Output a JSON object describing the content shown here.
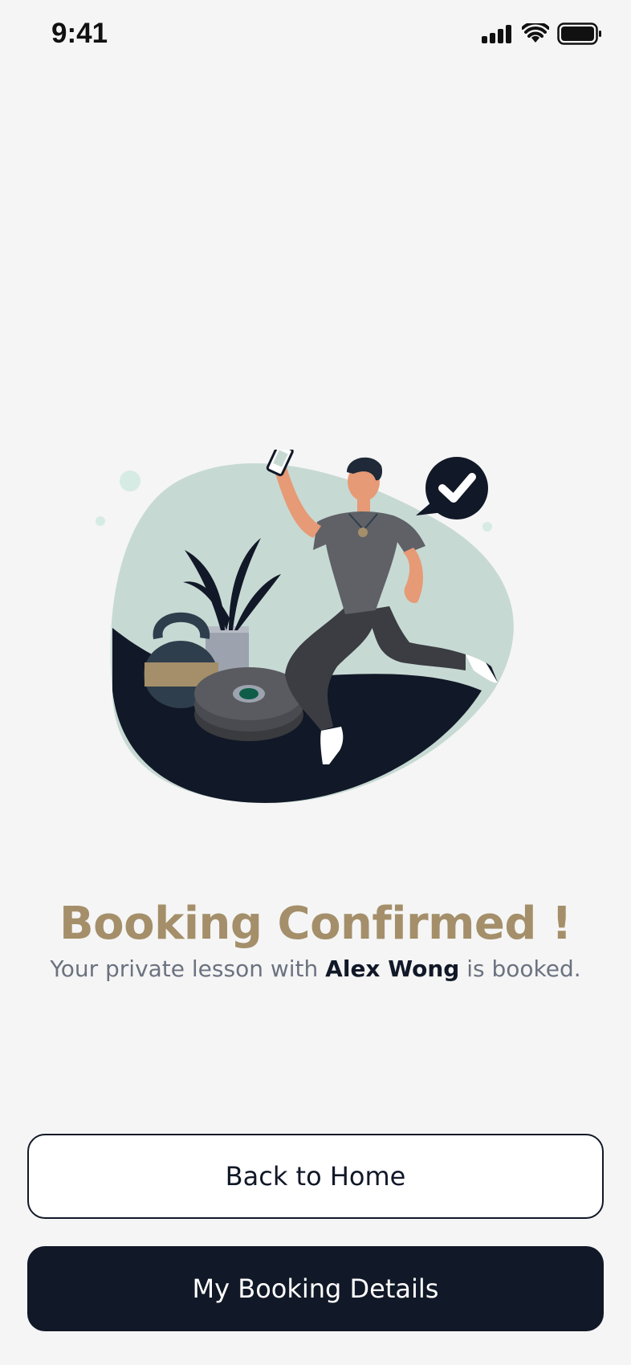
{
  "status_bar": {
    "time": "9:41",
    "icons": [
      "signal-icon",
      "wifi-icon",
      "battery-icon"
    ]
  },
  "illustration": {
    "description_icon": "booking-success-illustration"
  },
  "confirmation": {
    "title": "Booking Confirmed !",
    "subtitle_prefix": "Your private lesson with ",
    "trainer_name": "Alex Wong",
    "subtitle_suffix": " is booked."
  },
  "actions": {
    "back_home_label": "Back to Home",
    "booking_details_label": "My Booking Details"
  },
  "colors": {
    "title": "#a48f6a",
    "primary": "#111827",
    "background": "#f5f5f5"
  }
}
